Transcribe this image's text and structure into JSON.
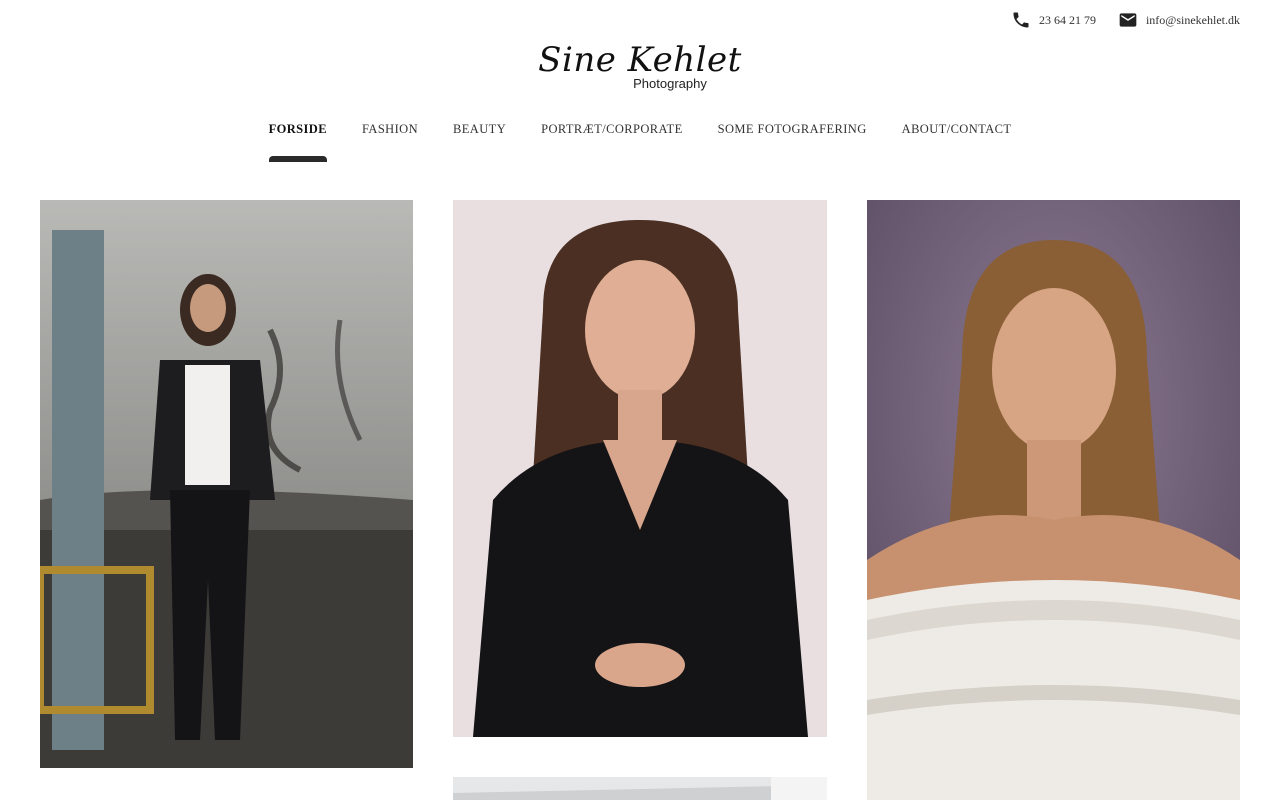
{
  "contact": {
    "phone": "23 64 21 79",
    "phone_icon": "phone-icon",
    "email": "info@sinekehlet.dk",
    "email_icon": "mail-icon"
  },
  "logo": {
    "script": "Sine Kehlet",
    "subtitle": "Photography"
  },
  "nav": {
    "items": [
      {
        "label": "FORSIDE",
        "active": true
      },
      {
        "label": "FASHION",
        "active": false
      },
      {
        "label": "BEAUTY",
        "active": false
      },
      {
        "label": "PORTRÆT/CORPORATE",
        "active": false
      },
      {
        "label": "SOME FOTOGRAFERING",
        "active": false
      },
      {
        "label": "ABOUT/CONTACT",
        "active": false
      }
    ]
  },
  "gallery": {
    "photos": [
      {
        "subject": "woman in studded leather jacket in industrial space"
      },
      {
        "subject": "woman in black blazer on pink background"
      },
      {
        "subject": "woman in white off-shoulder top on purple background"
      },
      {
        "subject": "architecture detail"
      }
    ]
  },
  "colors": {
    "background": "#ffffff",
    "text": "#222222",
    "active_indicator": "#2a2a2a"
  }
}
